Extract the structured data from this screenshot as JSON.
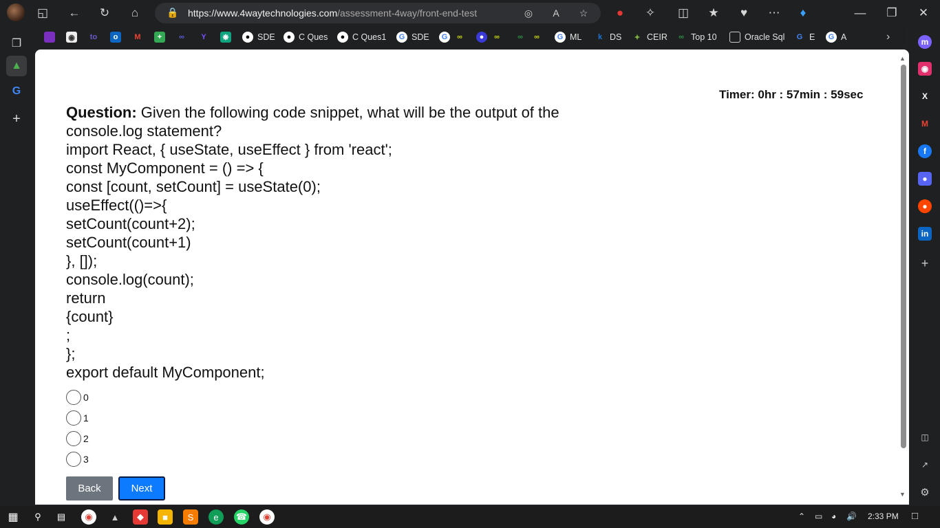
{
  "browser": {
    "url_domain": "https://www.4waytechnologies.com",
    "url_path": "/assessment-4way/front-end-test"
  },
  "bookmarks": [
    {
      "label": "",
      "color": "#7b2fbe"
    },
    {
      "label": "",
      "color": "#ffffff"
    },
    {
      "label": "",
      "color": "#6a5acd"
    },
    {
      "label": "",
      "color": "#0a66c2"
    },
    {
      "label": "",
      "color": "#ea4335"
    },
    {
      "label": "",
      "color": "#34a853"
    },
    {
      "label": "",
      "color": "#5b5bd6"
    },
    {
      "label": "",
      "color": "#7c4dff"
    },
    {
      "label": "",
      "color": "#10a37f"
    },
    {
      "label": "SDE",
      "color": "#ffffff"
    },
    {
      "label": "C Ques",
      "color": "#ffffff"
    },
    {
      "label": "C Ques1",
      "color": "#ffffff"
    },
    {
      "label": "SDE",
      "color": "#ffffff"
    },
    {
      "label": "",
      "color": "#ffffff"
    },
    {
      "label": "",
      "color": "#2f8d46"
    },
    {
      "label": "",
      "color": "#3a3ad6"
    },
    {
      "label": "",
      "color": "#2f8d46"
    },
    {
      "label": "",
      "color": "#2f8d46"
    },
    {
      "label": "",
      "color": "#2f8d46"
    },
    {
      "label": "ML",
      "color": "#ffffff"
    },
    {
      "label": "DS",
      "color": "#1976d2"
    },
    {
      "label": "CEIR",
      "color": "#7cb342"
    },
    {
      "label": "Top 10",
      "color": "#2f8d46"
    },
    {
      "label": "Oracle Sql",
      "color": "#e4e4e4"
    },
    {
      "label": "E",
      "color": "#ffffff"
    },
    {
      "label": "A",
      "color": "#ffffff"
    }
  ],
  "timer": {
    "text": "Timer: 0hr : 57min : 59sec"
  },
  "question": {
    "label": "Question:",
    "prompt": " Given the following code snippet, what will be the output of the console.log statement?",
    "code_lines": [
      "import React, { useState, useEffect } from 'react';",
      "const MyComponent = () => {",
      "const [count, setCount] = useState(0);",
      "useEffect(()=>{",
      "setCount(count+2);",
      "setCount(count+1)",
      "}, []);",
      "console.log(count);",
      "return",
      "{count}",
      ";",
      "};",
      "export default MyComponent;"
    ]
  },
  "options": [
    "0",
    "1",
    "2",
    "3"
  ],
  "buttons": {
    "back": "Back",
    "next": "Next"
  },
  "taskbar": {
    "time": "2:33 PM"
  }
}
